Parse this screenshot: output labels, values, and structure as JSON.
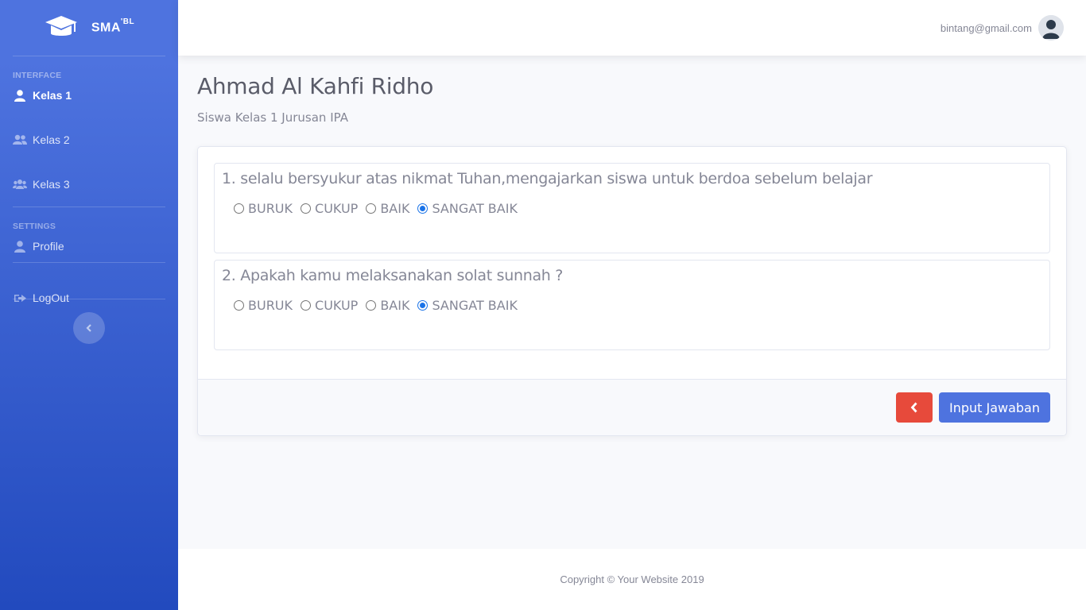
{
  "brand": {
    "name": "SMA",
    "suffix": "'BL"
  },
  "sidebar": {
    "heading_interface": "INTERFACE",
    "heading_settings": "SETTINGS",
    "items": [
      {
        "label": "Kelas 1",
        "icon": "user-icon",
        "active": true
      },
      {
        "label": "Kelas 2",
        "icon": "user-friends-icon",
        "active": false
      },
      {
        "label": "Kelas 3",
        "icon": "users-icon",
        "active": false
      },
      {
        "label": "Profile",
        "icon": "user-icon",
        "active": false
      },
      {
        "label": "LogOut",
        "icon": "sign-out-icon",
        "active": false
      }
    ]
  },
  "topbar": {
    "user_email": "bintang@gmail.com"
  },
  "page": {
    "title": "Ahmad Al Kahfi Ridho",
    "subtitle": "Siswa Kelas 1 Jurusan IPA"
  },
  "questions": [
    {
      "text": "1. selalu bersyukur atas nikmat Tuhan,mengajarkan siswa untuk berdoa sebelum belajar",
      "options": [
        "BURUK",
        "CUKUP",
        "BAIK",
        "SANGAT BAIK"
      ],
      "selected": "SANGAT BAIK"
    },
    {
      "text": "2. Apakah kamu melaksanakan solat sunnah ?",
      "options": [
        "BURUK",
        "CUKUP",
        "BAIK",
        "SANGAT BAIK"
      ],
      "selected": "SANGAT BAIK"
    }
  ],
  "actions": {
    "submit_label": "Input Jawaban"
  },
  "footer": {
    "copyright": "Copyright © Your Website 2019"
  },
  "colors": {
    "primary": "#4e73df",
    "danger": "#e74a3b",
    "radio_checked": "#1a73e8"
  }
}
